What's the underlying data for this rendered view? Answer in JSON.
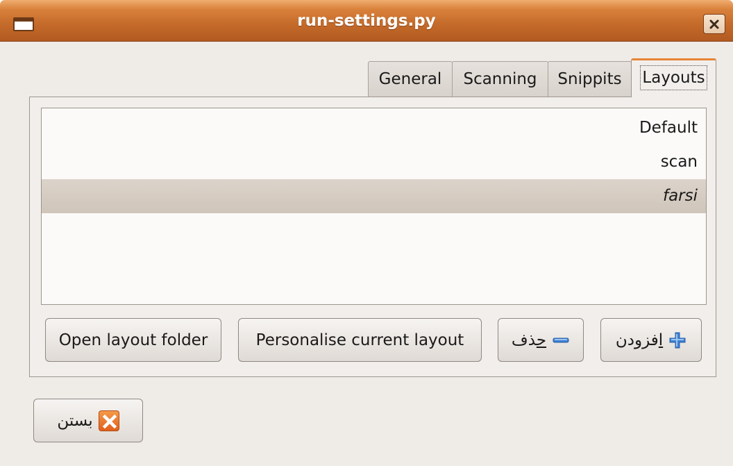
{
  "window": {
    "title": "run-settings.py"
  },
  "tabs": [
    {
      "label": "General"
    },
    {
      "label": "Scanning"
    },
    {
      "label": "Snippits"
    },
    {
      "label": "Layouts",
      "active": true
    }
  ],
  "layouts_list": [
    {
      "label": "Default"
    },
    {
      "label": "scan"
    },
    {
      "label": "farsi",
      "selected": true
    }
  ],
  "buttons": {
    "open_folder": "Open layout folder",
    "personalise": "Personalise current layout",
    "remove_rest": "ذف",
    "remove_mnemonic": "ح",
    "add_rest": "فزودن",
    "add_mnemonic": "ا",
    "close_rest": "ستن",
    "close_mnemonic": "ب"
  },
  "colors": {
    "titlebar": "#c46a2a",
    "selection": "#d5ccc2",
    "active_tab_accent": "#e68535",
    "add_icon": "#3d7fd1",
    "remove_icon": "#3d7fd1",
    "close_icon": "#e0601d"
  },
  "icons": {
    "window_menu": "window-menu-icon",
    "window_close": "window-close-icon",
    "add": "plus-icon",
    "remove": "minus-icon",
    "close": "close-x-icon"
  }
}
